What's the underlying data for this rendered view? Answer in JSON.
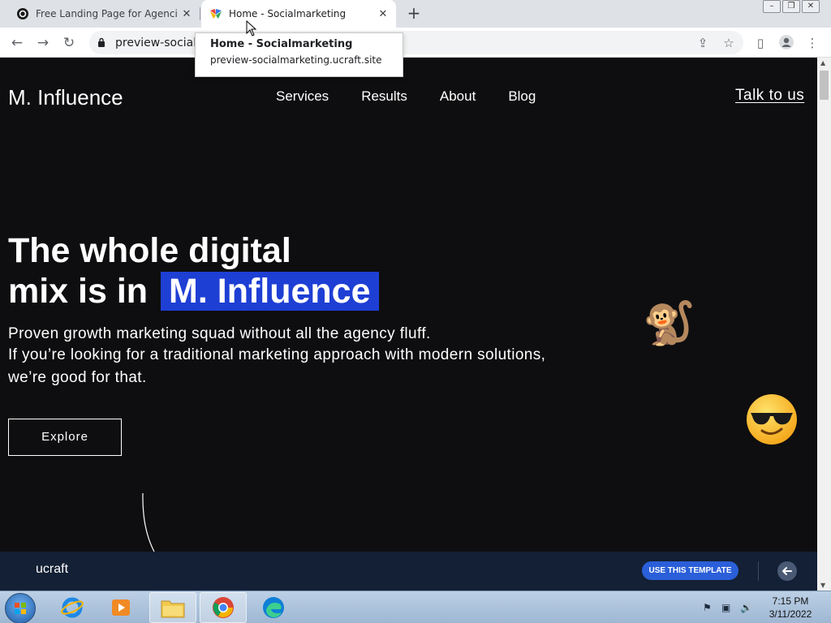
{
  "browser": {
    "tabs": [
      {
        "title": "Free Landing Page for Agencies - ",
        "active": false
      },
      {
        "title": "Home - Socialmarketing",
        "active": true
      }
    ],
    "new_tab_icon": "plus-icon",
    "address_bar": {
      "url": "preview-socialmarketing.ucraft.site"
    },
    "tooltip": {
      "title": "Home - Socialmarketing",
      "url": "preview-socialmarketing.ucraft.site"
    }
  },
  "site": {
    "brand": "M. Influence",
    "nav": [
      "Services",
      "Results",
      "About",
      "Blog"
    ],
    "cta_link": "Talk to us",
    "hero": {
      "line1": "The whole digital",
      "line2_prefix": "mix is in",
      "line2_highlight": "M. Influence",
      "highlight_color": "#1e3fd4",
      "sub1": "Proven growth marketing squad without all the agency fluff.",
      "sub2": "If you’re looking for a traditional marketing approach with modern solutions,",
      "sub3": "we’re good for that.",
      "button": "Explore"
    },
    "emojis": {
      "monkey": "🐒"
    }
  },
  "ucraft_bar": {
    "logo": "ucraft",
    "button": "USE THIS TEMPLATE",
    "button_color": "#2b5fd9"
  },
  "taskbar": {
    "time": "7:15 PM",
    "date": "3/11/2022"
  }
}
